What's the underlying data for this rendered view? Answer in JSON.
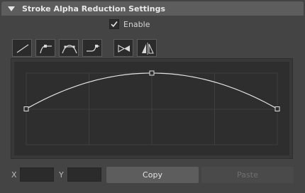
{
  "header": {
    "title": "Stroke Alpha Reduction Settings"
  },
  "enable": {
    "label": "Enable",
    "checked": true
  },
  "toolbar": {
    "buttons": [
      {
        "name": "linear-curve-preset-icon"
      },
      {
        "name": "ease-out-curve-preset-icon"
      },
      {
        "name": "bell-curve-preset-icon"
      },
      {
        "name": "ease-in-curve-preset-icon"
      },
      {
        "name": "flip-vertical-icon"
      },
      {
        "name": "flip-horizontal-icon"
      }
    ]
  },
  "graph": {
    "control_points": [
      {
        "x": 0.0,
        "y": 0.5
      },
      {
        "x": 0.5,
        "y": 1.0
      },
      {
        "x": 1.0,
        "y": 0.5
      }
    ]
  },
  "coords": {
    "x_label": "X",
    "y_label": "Y",
    "x_value": "",
    "y_value": ""
  },
  "actions": {
    "copy_label": "Copy",
    "paste_label": "Paste",
    "paste_enabled": false
  },
  "colors": {
    "header_bg": "#5d5d5d",
    "panel_bg": "#444444",
    "graph_bg": "#2e2e2e",
    "curve": "#e0e0e0",
    "grid": "#3b3b3b"
  }
}
